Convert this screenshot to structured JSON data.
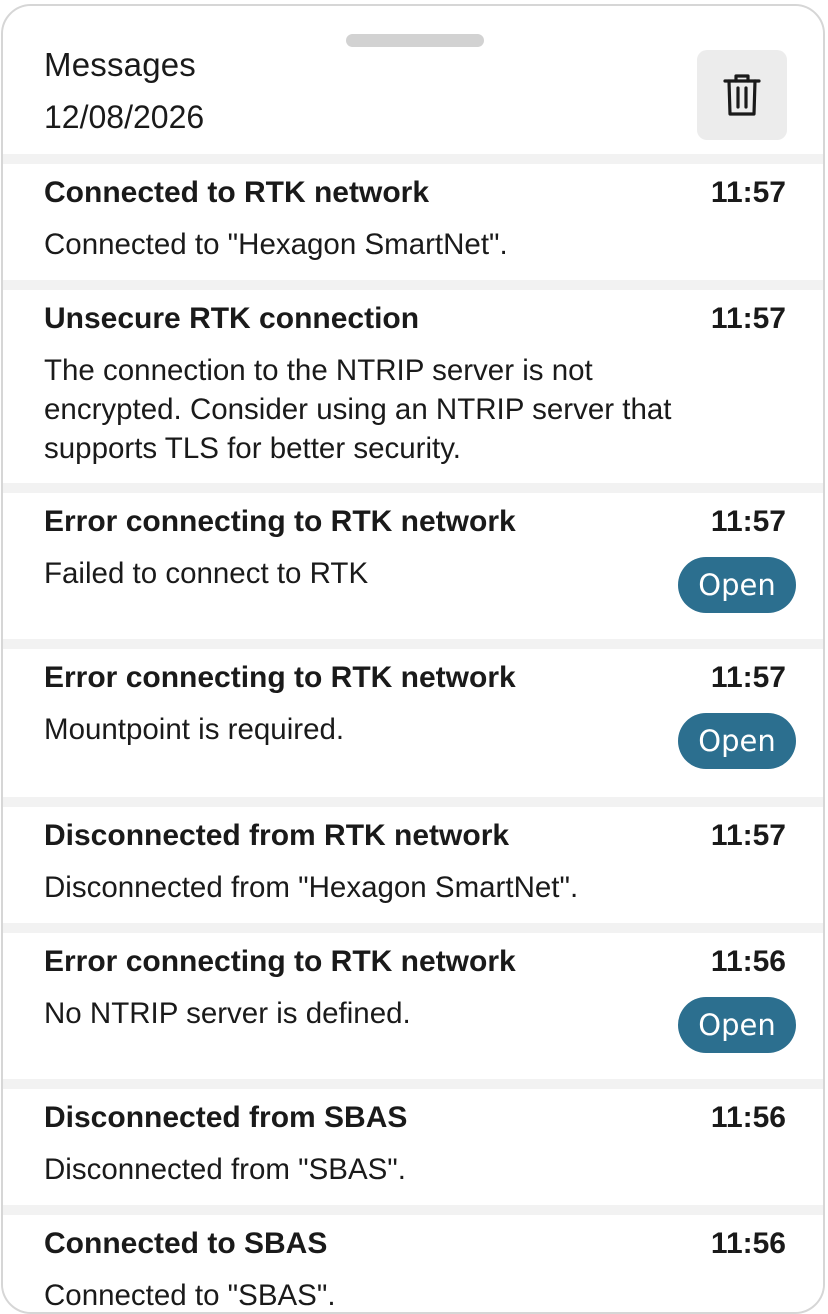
{
  "header": {
    "title": "Messages",
    "date": "12/08/2026",
    "delete_icon": "trash-icon"
  },
  "messages": [
    {
      "title": "Connected to RTK network",
      "time": "11:57",
      "body": "Connected to \"Hexagon SmartNet\".",
      "action": null
    },
    {
      "title": "Unsecure RTK connection",
      "time": "11:57",
      "body": "The connection to the NTRIP server is not encrypted. Consider using an NTRIP server that supports TLS for better security.",
      "action": null
    },
    {
      "title": "Error connecting to RTK network",
      "time": "11:57",
      "body": "Failed to connect to RTK",
      "action": "Open"
    },
    {
      "title": "Error connecting to RTK network",
      "time": "11:57",
      "body": "Mountpoint is required.",
      "action": "Open"
    },
    {
      "title": "Disconnected from RTK network",
      "time": "11:57",
      "body": "Disconnected from \"Hexagon SmartNet\".",
      "action": null
    },
    {
      "title": "Error connecting to RTK network",
      "time": "11:56",
      "body": "No NTRIP server is defined.",
      "action": "Open"
    },
    {
      "title": "Disconnected from SBAS",
      "time": "11:56",
      "body": "Disconnected from \"SBAS\".",
      "action": null
    },
    {
      "title": "Connected to SBAS",
      "time": "11:56",
      "body": "Connected to \"SBAS\".",
      "action": null
    }
  ],
  "colors": {
    "accent": "#2c6f8f",
    "background": "#f2f2f2"
  }
}
